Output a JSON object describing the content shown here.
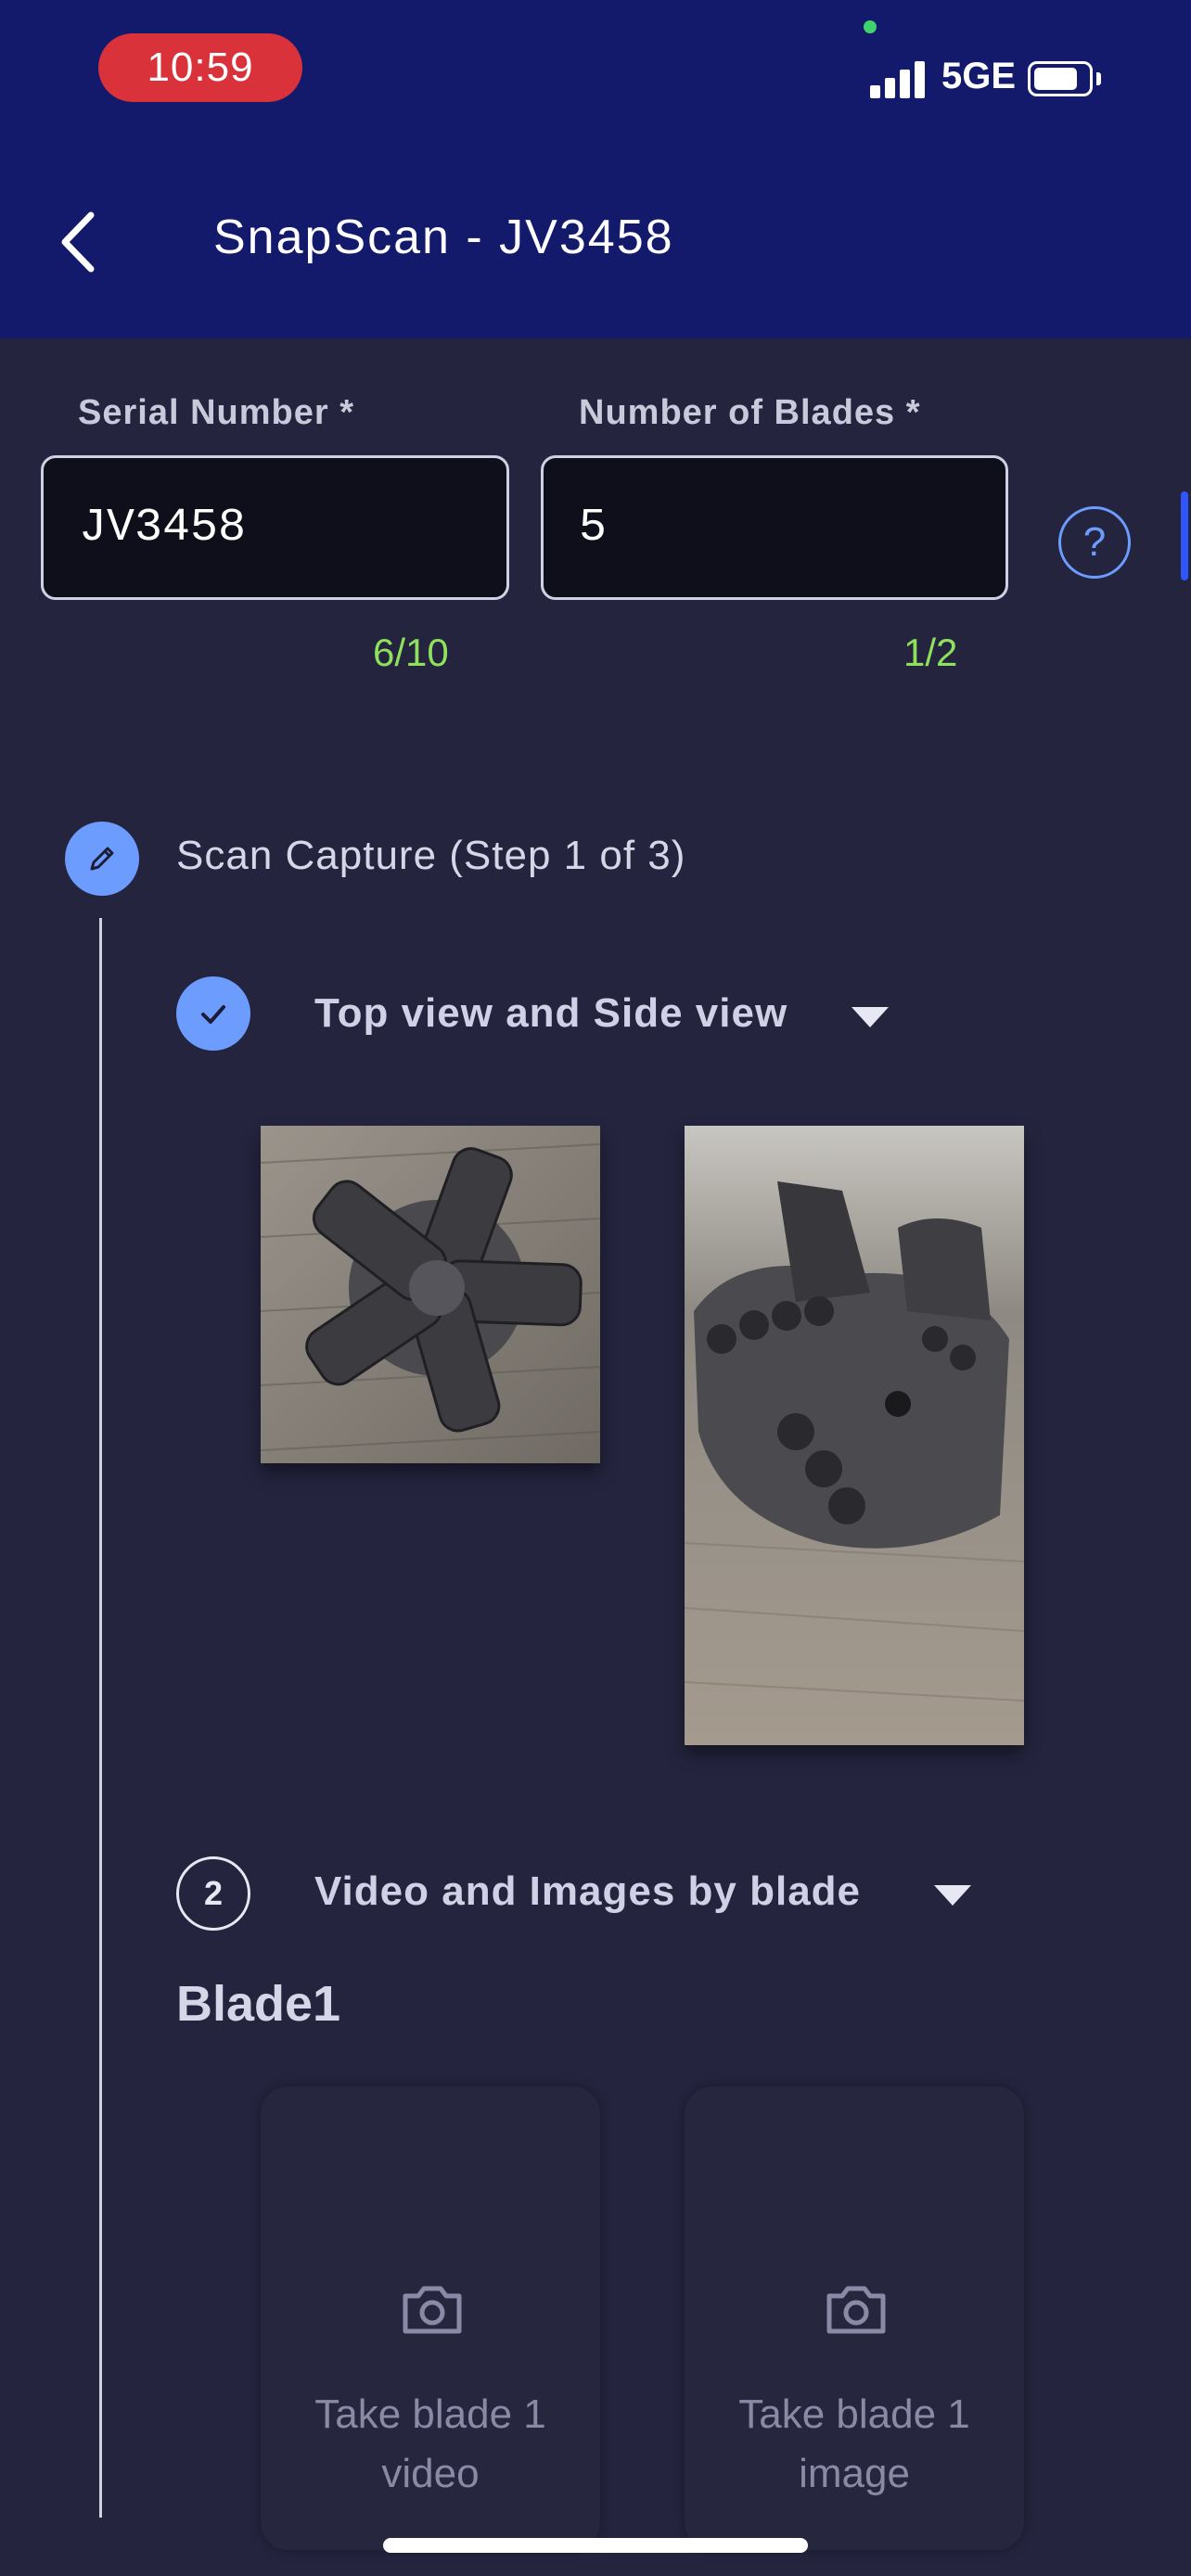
{
  "status_bar": {
    "time": "10:59",
    "network": "5GE"
  },
  "header": {
    "title": "SnapScan - JV3458"
  },
  "form": {
    "serial": {
      "label": "Serial Number *",
      "value": "JV3458",
      "count": "6/10"
    },
    "blades": {
      "label": "Number of Blades *",
      "value": "5",
      "count": "1/2"
    },
    "help": "?"
  },
  "steps": {
    "main": {
      "title": "Scan Capture (Step 1 of 3)"
    },
    "sub1": {
      "title": "Top view and Side view"
    },
    "sub2": {
      "number": "2",
      "title": "Video and Images by blade"
    }
  },
  "blade": {
    "heading": "Blade1",
    "cards": [
      {
        "caption": "Take blade 1 video"
      },
      {
        "caption": "Take blade 1 image"
      }
    ]
  },
  "colors": {
    "header": "#13196b",
    "background": "#24243f",
    "accent": "#6d9cff",
    "counter": "#8fe05c",
    "time_pill": "#d9323a"
  }
}
